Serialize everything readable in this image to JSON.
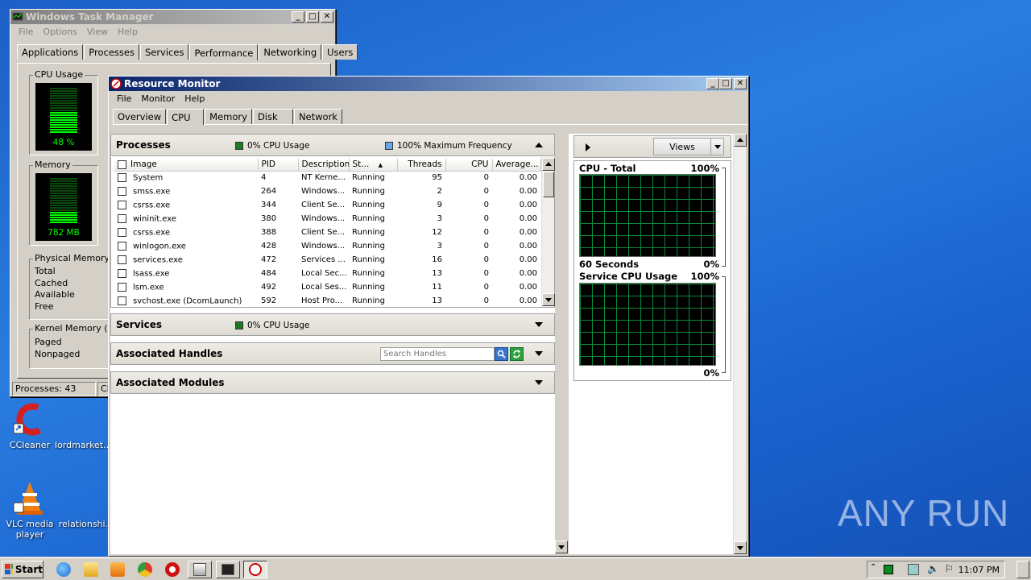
{
  "desktop": {
    "icons": [
      {
        "label": "CCleaner"
      },
      {
        "label": "lordmarket..."
      },
      {
        "label": "VLC media player"
      },
      {
        "label": "relationshi..."
      }
    ],
    "watermark": "ANY RUN"
  },
  "task_manager": {
    "title": "Windows Task Manager",
    "menu": [
      "File",
      "Options",
      "View",
      "Help"
    ],
    "tabs": [
      "Applications",
      "Processes",
      "Services",
      "Performance",
      "Networking",
      "Users"
    ],
    "selected_tab": "Performance",
    "cpu_usage_label": "CPU Usage",
    "cpu_usage_value": "48 %",
    "cpu_usage_fraction": 0.48,
    "memory_label": "Memory",
    "memory_value": "782 MB",
    "memory_fraction": 0.25,
    "physical_memory_label": "Physical Memory (M",
    "physical_rows": [
      "Total",
      "Cached",
      "Available",
      "Free"
    ],
    "kernel_memory_label": "Kernel Memory (MB",
    "kernel_rows": [
      "Paged",
      "Nonpaged"
    ],
    "status_processes": "Processes: 43",
    "status_cpu": "CF"
  },
  "resource_monitor": {
    "title": "Resource Monitor",
    "menu": [
      "File",
      "Monitor",
      "Help"
    ],
    "tabs": [
      "Overview",
      "CPU",
      "Memory",
      "Disk",
      "Network"
    ],
    "selected_tab": "CPU",
    "processes": {
      "title": "Processes",
      "cpu_usage": "0% CPU Usage",
      "max_freq": "100% Maximum Frequency",
      "columns": [
        "Image",
        "PID",
        "Description",
        "St...",
        "Threads",
        "CPU",
        "Average..."
      ],
      "rows": [
        {
          "image": "System",
          "pid": "4",
          "desc": "NT Kerne...",
          "status": "Running",
          "threads": "95",
          "cpu": "0",
          "avg": "0.00"
        },
        {
          "image": "smss.exe",
          "pid": "264",
          "desc": "Windows...",
          "status": "Running",
          "threads": "2",
          "cpu": "0",
          "avg": "0.00"
        },
        {
          "image": "csrss.exe",
          "pid": "344",
          "desc": "Client Se...",
          "status": "Running",
          "threads": "9",
          "cpu": "0",
          "avg": "0.00"
        },
        {
          "image": "wininit.exe",
          "pid": "380",
          "desc": "Windows...",
          "status": "Running",
          "threads": "3",
          "cpu": "0",
          "avg": "0.00"
        },
        {
          "image": "csrss.exe",
          "pid": "388",
          "desc": "Client Se...",
          "status": "Running",
          "threads": "12",
          "cpu": "0",
          "avg": "0.00"
        },
        {
          "image": "winlogon.exe",
          "pid": "428",
          "desc": "Windows...",
          "status": "Running",
          "threads": "3",
          "cpu": "0",
          "avg": "0.00"
        },
        {
          "image": "services.exe",
          "pid": "472",
          "desc": "Services ...",
          "status": "Running",
          "threads": "16",
          "cpu": "0",
          "avg": "0.00"
        },
        {
          "image": "lsass.exe",
          "pid": "484",
          "desc": "Local Sec...",
          "status": "Running",
          "threads": "13",
          "cpu": "0",
          "avg": "0.00"
        },
        {
          "image": "lsm.exe",
          "pid": "492",
          "desc": "Local Ses...",
          "status": "Running",
          "threads": "11",
          "cpu": "0",
          "avg": "0.00"
        },
        {
          "image": "svchost.exe (DcomLaunch)",
          "pid": "592",
          "desc": "Host Pro...",
          "status": "Running",
          "threads": "13",
          "cpu": "0",
          "avg": "0.00"
        }
      ]
    },
    "services": {
      "title": "Services",
      "cpu_usage": "0% CPU Usage"
    },
    "handles": {
      "title": "Associated Handles",
      "search_placeholder": "Search Handles"
    },
    "modules": {
      "title": "Associated Modules"
    },
    "right_pane": {
      "views_label": "Views",
      "cpu_total_label": "CPU - Total",
      "cpu_total_max": "100%",
      "cpu_total_time": "60 Seconds",
      "cpu_total_min": "0%",
      "service_cpu_label": "Service CPU Usage",
      "service_cpu_max": "100%",
      "service_cpu_min": "0%"
    }
  },
  "taskbar": {
    "start_label": "Start",
    "clock": "11:07 PM"
  },
  "colors": {
    "cpu_usage_square": "#1f7a1f",
    "max_freq_square": "#6aa6e8",
    "graph_grid": "#0a8a3a"
  }
}
